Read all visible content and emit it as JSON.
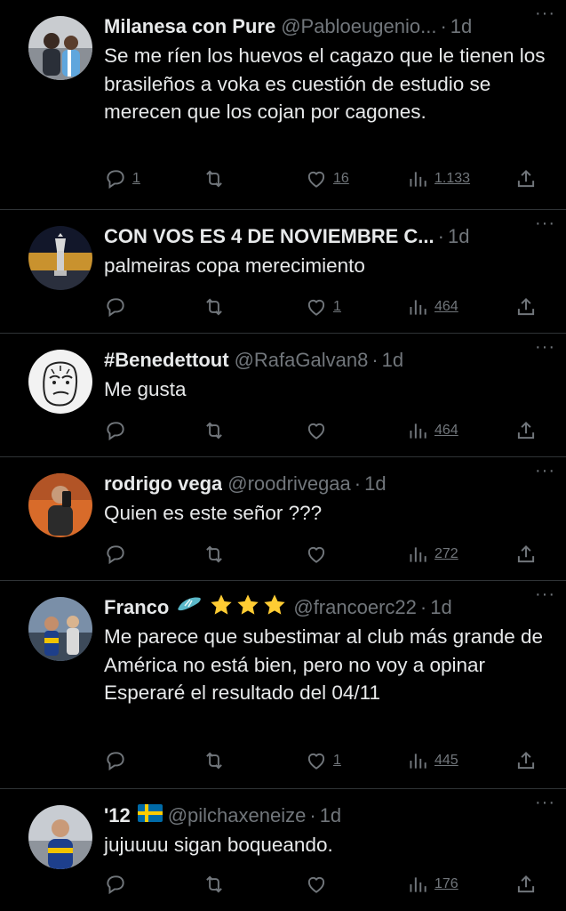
{
  "tweets": [
    {
      "name": "Milanesa con Pure",
      "handle": "@Pabloeugenio...",
      "time": "1d",
      "text": "Se me ríen los huevos el cagazo que le tienen los brasileños a voka es cuestión de estudio se merecen que los cojan por cagones.",
      "replies": "1",
      "likes": "16",
      "views": "1.133"
    },
    {
      "name": "CON VOS ES 4 DE NOVIEMBRE C...",
      "handle": "",
      "time": "1d",
      "text": "palmeiras copa merecimiento",
      "replies": "",
      "likes": "1",
      "views": "464"
    },
    {
      "name": "#Benedettout",
      "handle": "@RafaGalvan8",
      "time": "1d",
      "text": "Me gusta",
      "replies": "",
      "likes": "",
      "views": "464"
    },
    {
      "name": "rodrigo vega",
      "handle": "@roodrivegaa",
      "time": "1d",
      "text": "Quien es este señor ???",
      "replies": "",
      "likes": "",
      "views": "272"
    },
    {
      "name": "Franco",
      "handle": "@francoerc22",
      "time": "1d",
      "text": "Me parece que subestimar al club más grande de América no está bien, pero no voy a opinar\nEsperaré el resultado del 04/11",
      "replies": "",
      "likes": "1",
      "views": "445"
    },
    {
      "name": "'12",
      "handle": "@pilchaxeneize",
      "time": "1d",
      "text": "jujuuuu sigan boqueando.",
      "replies": "",
      "likes": "",
      "views": "176"
    }
  ],
  "ui": {
    "more": "···",
    "sep": "·"
  },
  "icons": [
    "reply-icon",
    "retweet-icon",
    "like-icon",
    "views-icon",
    "share-icon",
    "more-icon"
  ],
  "colors": {
    "background": "#000000",
    "text": "#e7e9ea",
    "muted": "#71767b",
    "divider": "#2f3336"
  }
}
